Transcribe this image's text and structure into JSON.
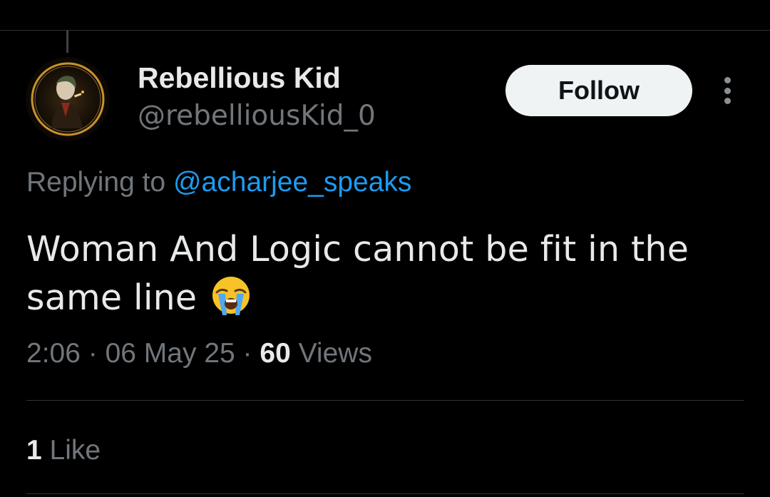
{
  "author": {
    "display_name": "Rebellious Kid",
    "handle": "@rebelliousKid_0",
    "avatar_icon": "joker-portrait-avatar"
  },
  "actions": {
    "follow_label": "Follow",
    "more_icon": "more-vertical-icon"
  },
  "reply": {
    "prefix": "Replying to",
    "mention": "@acharjee_speaks"
  },
  "tweet": {
    "text": "Woman And Logic cannot be fit in the same line",
    "emoji": "loudly-crying-face-emoji"
  },
  "meta": {
    "time": "2:06",
    "separator": "·",
    "date": "06 May 25",
    "views_count": "60",
    "views_label": "Views"
  },
  "engagement": {
    "likes_count": "1",
    "likes_label": "Like"
  },
  "colors": {
    "background": "#000000",
    "text_primary": "#e7e9ea",
    "text_secondary": "#71767b",
    "link": "#1d9bf0",
    "divider": "#2f3336",
    "follow_bg": "#eff3f4"
  }
}
